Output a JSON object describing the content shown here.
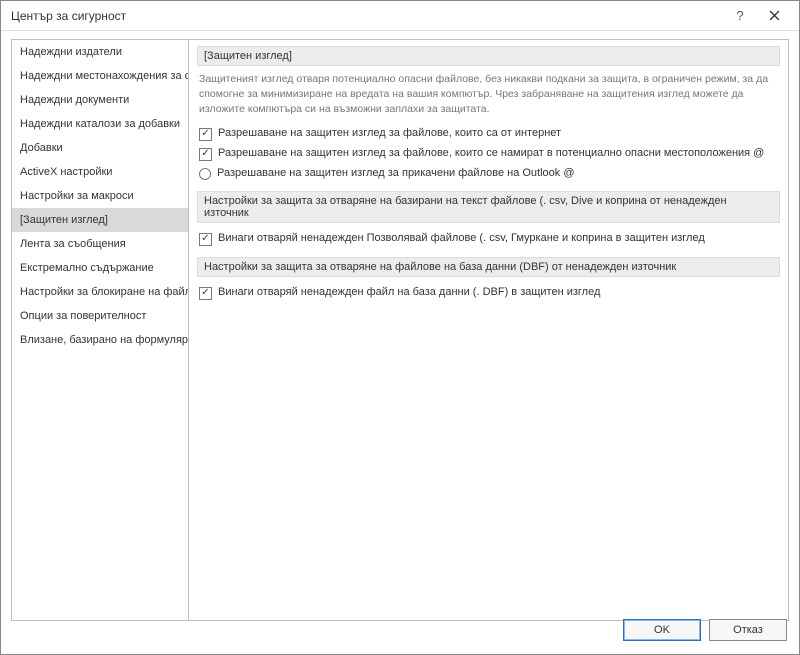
{
  "window": {
    "title": "Център за сигурност"
  },
  "sidebar": {
    "items": [
      {
        "label": "Надеждни издатели"
      },
      {
        "label": "Надеждни местонахождения за съдържание"
      },
      {
        "label": "Надеждни документи"
      },
      {
        "label": "Надеждни каталози за добавки"
      },
      {
        "label": "Добавки"
      },
      {
        "label": "ActiveX настройки"
      },
      {
        "label": "Настройки за макроси"
      },
      {
        "label": "[Защитен изглед]"
      },
      {
        "label": "Лента за съобщения"
      },
      {
        "label": "Екстремално съдържание"
      },
      {
        "label": "Настройки за блокиране на файлове"
      },
      {
        "label": "Опции за поверителност"
      },
      {
        "label": "Влизане, базирано на формуляри"
      }
    ],
    "selected_index": 7
  },
  "main": {
    "section1": {
      "title": "[Защитен изглед]",
      "desc": "Защитеният изглед отваря потенциално опасни файлове, без никакви подкани за защита, в ограничен режим, за да спомогне за минимизиране на вредата на вашия компютър. Чрез забраняване на защитения изглед можете да изложите компютъра си на възможни заплахи за защитата.",
      "opt1": "Разрешаване на защитен изглед за файлове, които са от интернет",
      "opt2": "Разрешаване на защитен изглед за файлове, които се намират в потенциално опасни местоположения @",
      "opt3": "Разрешаване на защитен изглед за прикачени файлове на Outlook @"
    },
    "section2": {
      "title": "Настройки за защита за отваряне на базирани на текст файлове (. csv, Dive и коприна от ненадежден източник",
      "opt1": "Винаги отваряй ненадежден Позволявай файлове (. csv, Гмуркане и коприна в защитен изглед"
    },
    "section3": {
      "title": "Настройки за защита за отваряне на файлове на база данни (DBF) от ненадежден източник",
      "opt1": "Винаги отваряй ненадежден файл на база данни (. DBF) в защитен изглед"
    }
  },
  "buttons": {
    "ok": "OK",
    "cancel": "Отказ"
  }
}
